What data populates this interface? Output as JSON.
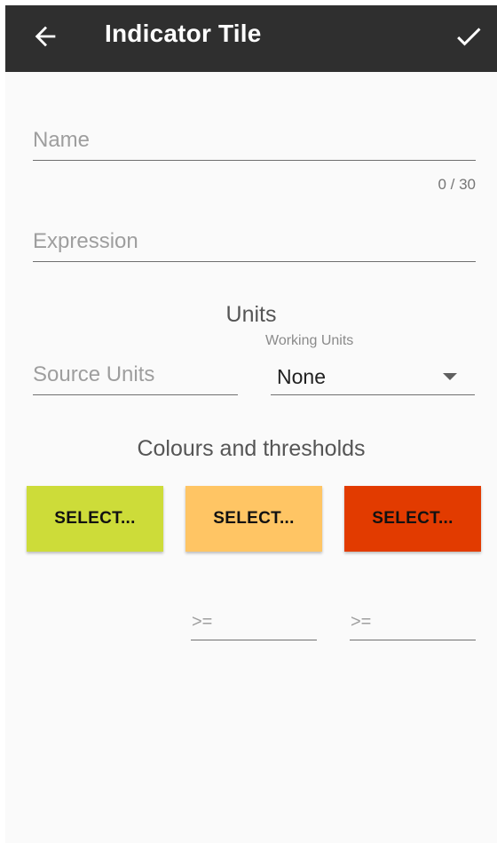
{
  "app_bar": {
    "title": "Indicator Tile",
    "back_icon": "arrow-back-icon",
    "confirm_icon": "check-icon",
    "background": "#2f2f2f"
  },
  "form": {
    "name": {
      "placeholder": "Name",
      "value": "",
      "counter": "0 / 30"
    },
    "expression": {
      "placeholder": "Expression",
      "value": ""
    },
    "units": {
      "heading": "Units",
      "source_units": {
        "placeholder": "Source Units",
        "value": ""
      },
      "working_units": {
        "label": "Working Units",
        "selected": "None"
      }
    },
    "colours": {
      "heading": "Colours and thresholds",
      "buttons": [
        {
          "label": "SELECT...",
          "color": "#cddc39"
        },
        {
          "label": "SELECT...",
          "color": "#ffc564"
        },
        {
          "label": "SELECT...",
          "color": "#e23b00"
        }
      ],
      "thresholds": [
        {
          "placeholder": ">=",
          "value": ""
        },
        {
          "placeholder": ">=",
          "value": ""
        }
      ]
    }
  }
}
